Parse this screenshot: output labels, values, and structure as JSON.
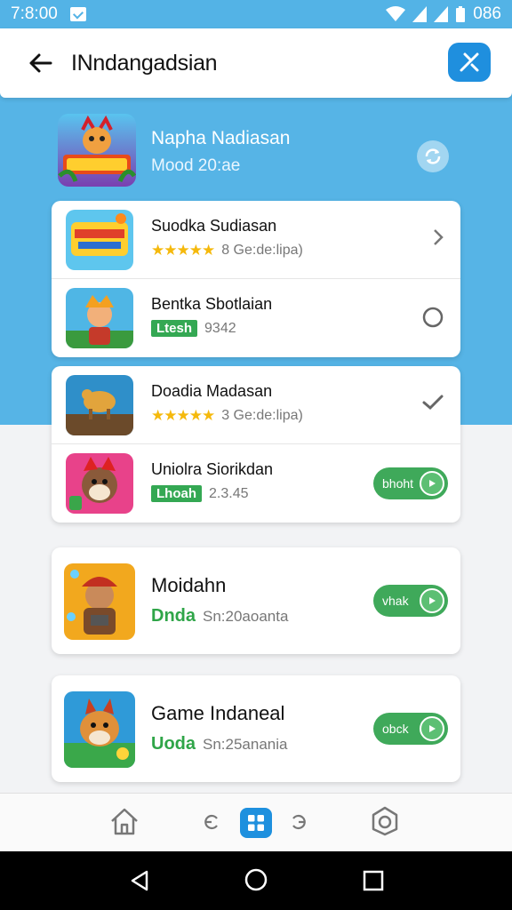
{
  "status": {
    "time": "7:8:00",
    "battery": "086"
  },
  "app_bar": {
    "title": "INndangadsian"
  },
  "featured": {
    "title": "Napha Nadiasan",
    "subtitle": "Mood 20:ae"
  },
  "list": [
    {
      "name": "Suodka Sudiasan",
      "stars": "★★★★★",
      "meta": "8 Ge:de:lipa)",
      "trail": "chevron"
    },
    {
      "name": "Bentka Sbotlaian",
      "tag": "Ltesh",
      "meta": "9342",
      "trail": "radio"
    },
    {
      "name": "Doadia Madasan",
      "stars": "★★★★★",
      "meta": "3 Ge:de:lipa)",
      "trail": "check"
    },
    {
      "name": "Uniolra Siorikdan",
      "tag": "Lhoah",
      "meta": "2.3.45",
      "trail": "pill",
      "pill": "bhoht"
    }
  ],
  "big_list": [
    {
      "name": "Moidahn",
      "green": "Dnda",
      "meta": "Sn:20aoanta",
      "pill": "vhak"
    },
    {
      "name": "Game Indaneal",
      "green": "Uoda",
      "meta": "Sn:25anania",
      "pill": "obck"
    }
  ]
}
